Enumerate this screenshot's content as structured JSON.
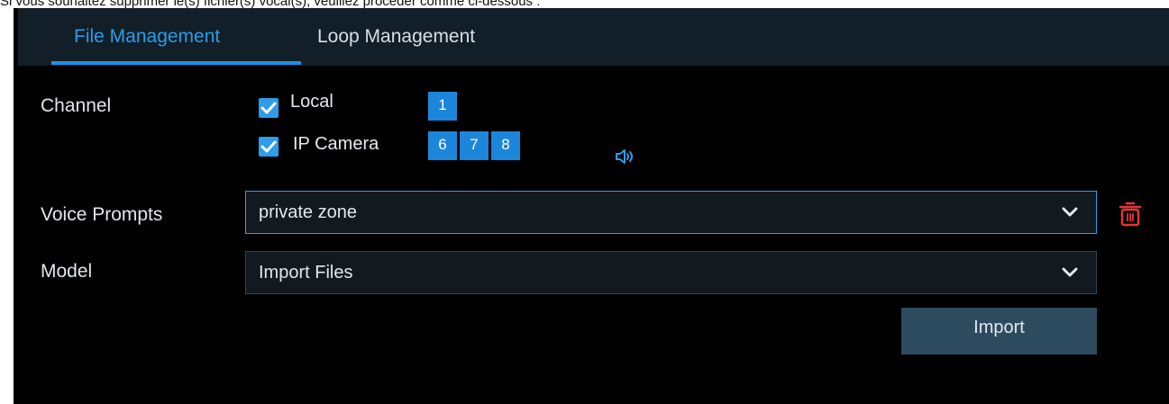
{
  "caption": "Si vous souhaitez supprimer le(s) fichier(s) vocal(s), veuillez procéder comme ci-dessous :",
  "tabs": [
    {
      "label": "File Management",
      "active": true
    },
    {
      "label": "Loop Management",
      "active": false
    }
  ],
  "form": {
    "channel_label": "Channel",
    "local_label": "Local",
    "local_checked": true,
    "local_channels": [
      "1"
    ],
    "ip_camera_label": "IP Camera",
    "ip_camera_checked": true,
    "ip_channels": [
      "6",
      "7",
      "8"
    ],
    "speaker_icon": "speaker-icon",
    "voice_prompts_label": "Voice Prompts",
    "voice_prompts_value": "private zone",
    "delete_icon": "trash-icon",
    "model_label": "Model",
    "model_value": "Import Files",
    "import_button": "Import"
  },
  "colors": {
    "accent": "#2b9be8",
    "delete": "#e8333a",
    "background": "#000000",
    "tabbar": "#121f28",
    "button": "#2c4b5f"
  }
}
